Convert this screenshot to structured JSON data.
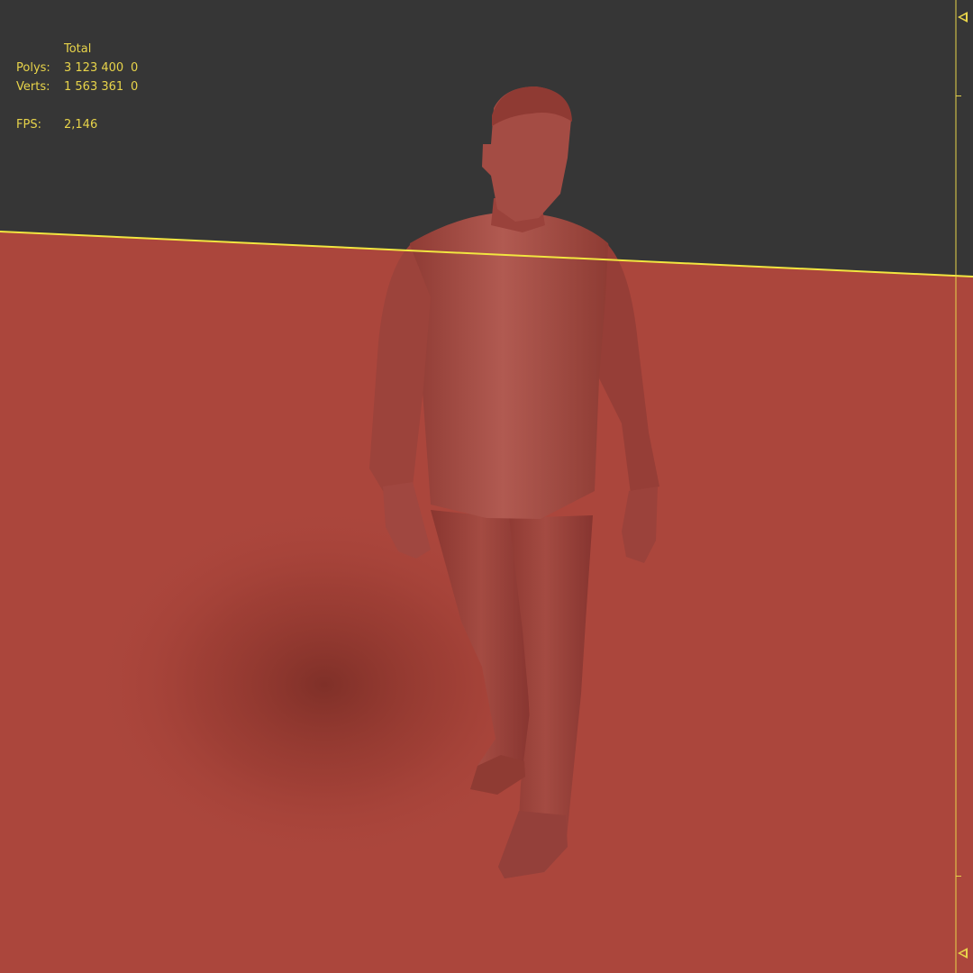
{
  "stats": {
    "header": "Total",
    "rows": [
      {
        "label": "Polys:",
        "value": "3 123 400",
        "selected": "0"
      },
      {
        "label": "Verts:",
        "value": "1 563 361",
        "selected": "0"
      },
      {
        "label": "FPS:",
        "value": "2,146",
        "selected": ""
      }
    ]
  },
  "colors": {
    "background": "#363636",
    "ground": "#ab463c",
    "model": "#a84d45",
    "overlay_text": "#e8d44a",
    "horizon_line": "#f2e640"
  },
  "icons": [
    "ruler-top-arrow-icon",
    "ruler-bottom-arrow-icon"
  ]
}
